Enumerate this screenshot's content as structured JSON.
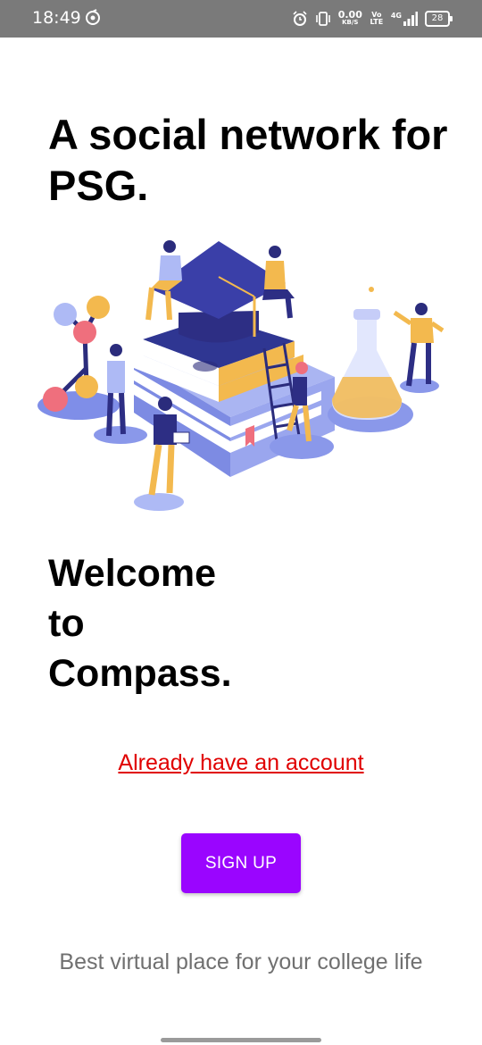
{
  "status_bar": {
    "time": "18:49",
    "net_speed_value": "0.00",
    "net_speed_unit": "KB/S",
    "volte": "Vo LTE",
    "network": "4G",
    "battery": "28"
  },
  "headline": "A social network for PSG.",
  "illustration": {
    "icon": "graduation-illustration"
  },
  "welcome": {
    "line1": "Welcome",
    "line2": "to",
    "line3": "Compass."
  },
  "login_link": "Already have an account",
  "signup_button": "SIGN UP",
  "tagline": "Best virtual place for your college life",
  "colors": {
    "accent": "#9a05ff",
    "link": "#e00000",
    "status_bar": "#7a7a7a"
  }
}
